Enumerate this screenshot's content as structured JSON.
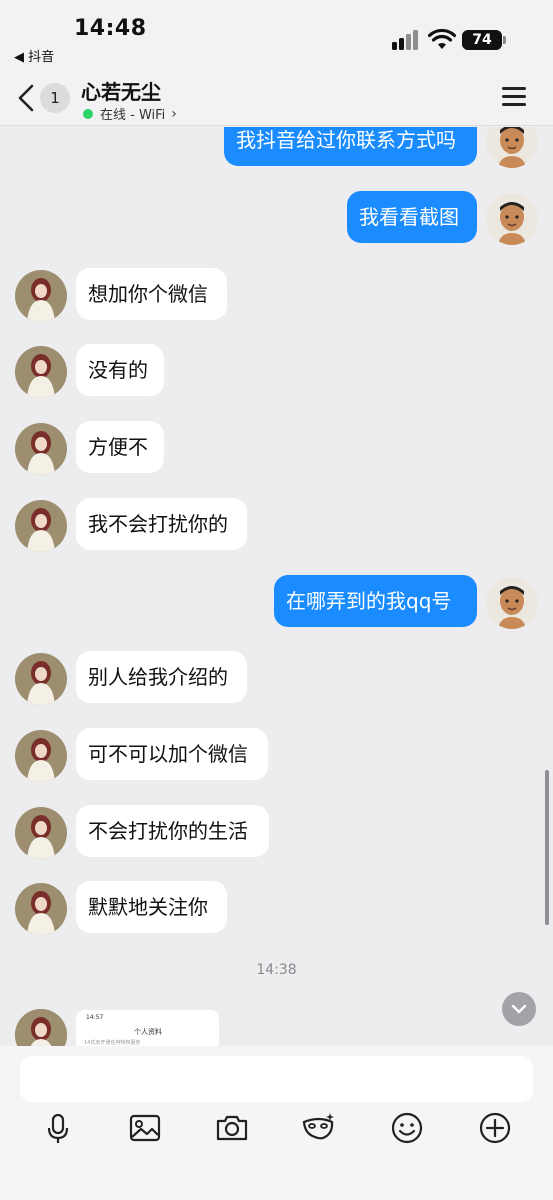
{
  "status_bar": {
    "time": "14:48",
    "back_app": "◀ 抖音",
    "battery": "74"
  },
  "header": {
    "unread_count": "1",
    "contact_name": "心若无尘",
    "status": "在线 - WiFi"
  },
  "messages": [
    {
      "direction": "out",
      "text": "我抖音给过你联系方式吗"
    },
    {
      "direction": "out",
      "text": "我看看截图"
    },
    {
      "direction": "in",
      "text": "想加你个微信"
    },
    {
      "direction": "in",
      "text": "没有的"
    },
    {
      "direction": "in",
      "text": "方便不"
    },
    {
      "direction": "in",
      "text": "我不会打扰你的"
    },
    {
      "direction": "out",
      "text": "在哪弄到的我qq号"
    },
    {
      "direction": "in",
      "text": "别人给我介绍的"
    },
    {
      "direction": "in",
      "text": "可不可以加个微信"
    },
    {
      "direction": "in",
      "text": "不会打扰你的生活"
    },
    {
      "direction": "in",
      "text": "默默地关注你"
    }
  ],
  "timestamp": "14:38",
  "screenshot_thumb": {
    "time": "14:57",
    "title": "个人资料",
    "subtitle": "14式未开通任何特权服务"
  },
  "input": {
    "placeholder": ""
  },
  "colors": {
    "outgoing_bubble": "#1a8cff",
    "incoming_bubble": "#ffffff",
    "online_dot": "#2bd46a"
  },
  "toolbar_icons": [
    "microphone-icon",
    "image-icon",
    "camera-icon",
    "mask-sticker-icon",
    "emoji-icon",
    "plus-icon"
  ]
}
